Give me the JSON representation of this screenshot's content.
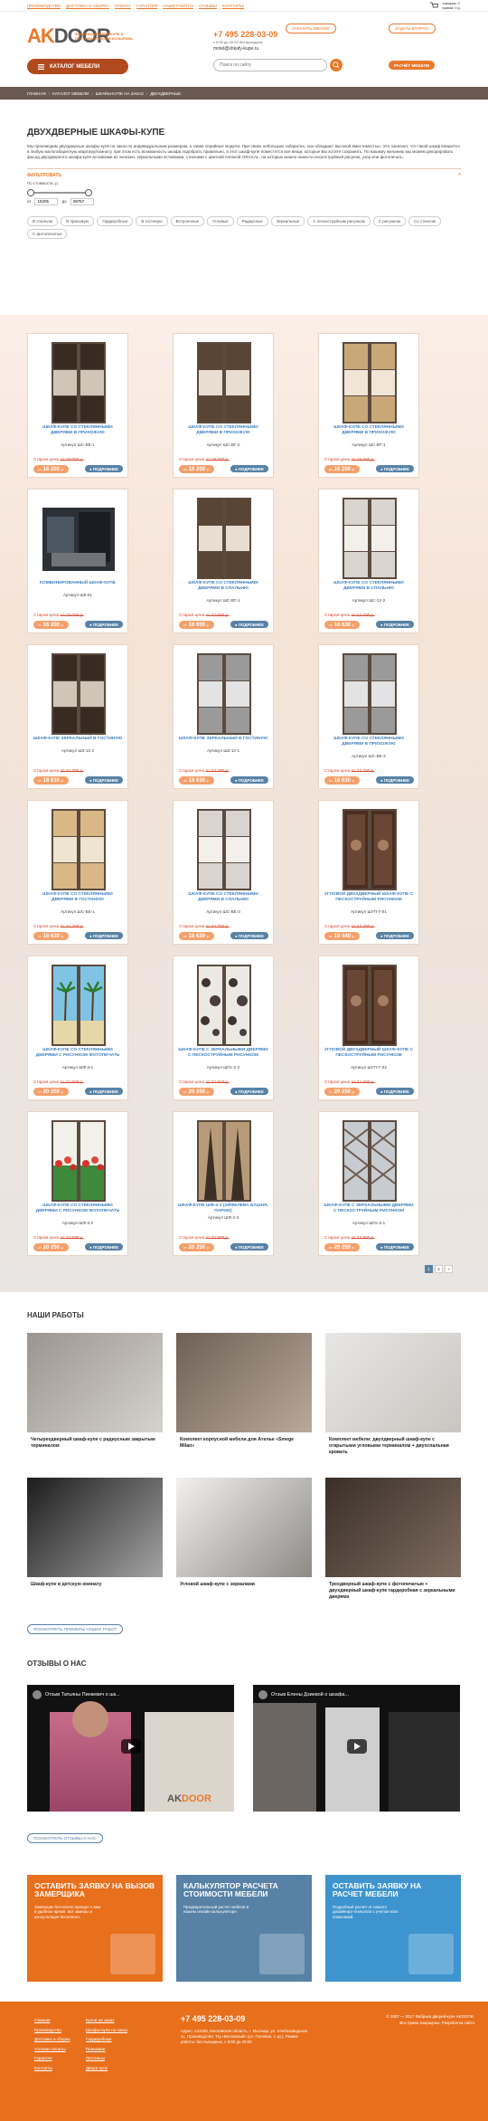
{
  "topnav": {
    "links": [
      "ПРОИЗВОДСТВО",
      "ДОСТАВКА И СБОРКА",
      "ОПЛАТА",
      "ГАРАНТИЯ",
      "НАШИ РАБОТЫ",
      "ОТЗЫВЫ",
      "КОНТАКТЫ"
    ],
    "cart_count": "товаров: 0",
    "cart_sum": "сумма: 0 р."
  },
  "header": {
    "logo_a": "AK",
    "logo_b": "DOOR",
    "tagline": "ФАБРИКА ДВЕРЕЙ-КУПЕ И ЛЕСТНИЦ АЛЕКСЕЯ КОЗЫРЕВА",
    "phone": "+7 495 228-03-09",
    "phone_sub": "с 9:00 до 20:00 без выходных",
    "email": "motel@shkafy-kupe.ru",
    "callback": "ЗАКАЗАТЬ ЗВОНОК",
    "ask": "ЗАДАТЬ ВОПРОС",
    "catalog": "КАТАЛОГ МЕБЕЛИ",
    "search_placeholder": "Поиск по сайту",
    "calc": "РАСЧЁТ МЕБЕЛИ"
  },
  "breadcrumbs": [
    "ГЛАВНАЯ",
    "КАТАЛОГ МЕБЕЛИ",
    "ШКАФЫ-КУПЕ НА ЗАКАЗ",
    "ДВУХДВЕРНЫЕ"
  ],
  "page": {
    "title": "ДВУХДВЕРНЫЕ ШКАФЫ-КУПЕ",
    "intro": "Мы производим двухдверные шкафы-купе на заказ по индивидуальным размерам, а также серийные модели. При своих небольших габаритах, они обладают высокой вместимостью. Это означает, что такой шкаф впишется в любую малогабаритную квартиру/комнату, при этом есть возможность шкафа подобрать правильно, в этот шкаф-купе поместятся все вещи, которые Вы хотите сохранить. По вашему желанию мы можем декорировать фасад двухдверного шкафа-купе вставками из экокожи, зеркальными вставками, стеклами с цветной пленкой ORACAL, на которые можно нанести пескоструйный рисунок, узор или фотопечать."
  },
  "filter": {
    "title": "ФИЛЬТРОВАТЬ",
    "price_label": "По стоимости, р.",
    "from_label": "от",
    "from": "15205",
    "to_label": "до",
    "to": "29757",
    "tags": [
      "В спальню",
      "В прихожую",
      "Гардеробные",
      "В гостиную",
      "Встроенные",
      "Угловые",
      "Радиусные",
      "Зеркальные",
      "С пескоструйным рисунком",
      "С рисунком",
      "Со стеклом",
      "С фотопечатью"
    ]
  },
  "catalog": {
    "old_label": "Старая цена",
    "price_prefix": "от",
    "more": "ПОДРОБНЕЕ",
    "items": [
      {
        "name": "ШКАФ-КУПЕ СО СТЕКЛЯННЫМИ ДВЕРЯМИ В ПРИХОЖУЮ",
        "art": "Артикул ШС-ВЕ-1",
        "old": "от 19 000 р.",
        "price": "16 200",
        "door": "dark"
      },
      {
        "name": "ШКАФ-КУПЕ СО СТЕКЛЯННЫМИ ДВЕРЯМИ В ПРИХОЖУЮ",
        "art": "Артикул ШС-ВГ-2",
        "old": "от 19 000 р.",
        "price": "16 200",
        "door": "wenge"
      },
      {
        "name": "ШКАФ-КУПЕ СО СТЕКЛЯННЫМИ ДВЕРЯМИ В ПРИХОЖУЮ",
        "art": "Артикул ШС-ВТ-1",
        "old": "от 19 000 р.",
        "price": "16 200",
        "door": "light"
      },
      {
        "name": "КОМБИНИРОВАННЫЙ ШКАФ-КУПЕ",
        "art": "Артикул ШК-К1",
        "old": "от 19 000 р.",
        "price": "16 200",
        "door": "room"
      },
      {
        "name": "ШКАФ-КУПЕ СО СТЕКЛЯННЫМИ ДВЕРЯМИ В СПАЛЬНЮ",
        "art": "Артикул ШС-ВТ-1",
        "old": "от 22 000 р.",
        "price": "18 000",
        "door": "wenge"
      },
      {
        "name": "ШКАФ-КУПЕ СО СТЕКЛЯННЫМИ ДВЕРЯМИ В СПАЛЬНЮ",
        "art": "Артикул ШС-12-2",
        "old": "от 22 700 р.",
        "price": "18 630",
        "door": "white"
      },
      {
        "name": "ШКАФ-КУПЕ ЗЕРКАЛЬНЫЙ В ГОСТИНУЮ",
        "art": "Артикул ШЗ-12-2",
        "old": "от 22 700 р.",
        "price": "18 630",
        "door": "dark"
      },
      {
        "name": "ШКАФ-КУПЕ ЗЕРКАЛЬНЫЙ В ГОСТИНУЮ",
        "art": "Артикул ШЗ-12-1",
        "old": "от 22 700 р.",
        "price": "18 630",
        "door": "grey"
      },
      {
        "name": "ШКАФ-КУПЕ СО СТЕКЛЯННЫМИ ДВЕРЯМИ В ПРИХОЖУЮ",
        "art": "Артикул ШС-ВЕ-2",
        "old": "от 22 700 р.",
        "price": "18 630",
        "door": "grey"
      },
      {
        "name": "ШКАФ-КУПЕ СО СТЕКЛЯННЫМИ ДВЕРЯМИ В ГОСТИНУЮ",
        "art": "Артикул ШС-ВЕ-1",
        "old": "от 22 700 р.",
        "price": "18 630",
        "door": "beige"
      },
      {
        "name": "ШКАФ-КУПЕ СО СТЕКЛЯННЫМИ ДВЕРЯМИ В СПАЛЬНЮ",
        "art": "Артикул ШС-ВЕ-3",
        "old": "от 22 700 р.",
        "price": "18 630",
        "door": "white"
      },
      {
        "name": "УГЛОВОЙ ДВУХДВЕРНЫЙ ШКАФ-КУПЕ С ПЕСКОСТРУЙНЫМ РИСУНКОМ",
        "art": "Артикул ШУП-Т-01",
        "old": "от 23 400 р.",
        "price": "19 440",
        "door": "corner"
      },
      {
        "name": "ШКАФ-КУПЕ СО СТЕКЛЯННЫМИ ДВЕРЯМИ С РИСУНКОМ ФОТОПЕЧАТЬ",
        "art": "Артикул ШФ-3-1",
        "old": "от 22 500 р.",
        "price": "20 250",
        "door": "palm"
      },
      {
        "name": "ШКАФ-КУПЕ С ЗЕРКАЛЬНЫМИ ДВЕРЯМИ С ПЕСКОСТРУЙНЫМ РИСУНКОМ",
        "art": "Артикул ШПс-2-2",
        "old": "от 22 500 р.",
        "price": "20 250",
        "door": "flower"
      },
      {
        "name": "УГЛОВОЙ ДВУХДВЕРНЫЙ ШКАФ-КУПЕ С ПЕСКОСТРУЙНЫМ РИСУНКОМ",
        "art": "Артикул ШУП-Т-02",
        "old": "от 22 500 р.",
        "price": "20 250",
        "door": "corner"
      },
      {
        "name": "ШКАФ-КУПЕ СО СТЕКЛЯННЫМИ ДВЕРЯМИ С РИСУНКОМ ФОТОПЕЧАТЬ",
        "art": "Артикул ШФ-3-2",
        "old": "от 22 500 р.",
        "price": "20 250",
        "door": "tulip"
      },
      {
        "name": "ШКАФ-КУПЕ ШФ-2-3 (ЭЙФЕЛЕВА БАШНЯ, ПАРИЖ)",
        "art": "Артикул ШФ-2-3",
        "old": "от 22 500 р.",
        "price": "20 250",
        "door": "tower"
      },
      {
        "name": "ШКАФ-КУПЕ С ЗЕРКАЛЬНЫМИ ДВЕРЯМИ С ПЕСКОСТРУЙНЫМ РИСУНКОМ",
        "art": "Артикул ШПс-2-1",
        "old": "от 22 500 р.",
        "price": "20 250",
        "door": "pattern"
      }
    ],
    "pages": [
      "1",
      "2",
      "»"
    ]
  },
  "works": {
    "title": "НАШИ РАБОТЫ",
    "items": [
      "Четырехдверный шкаф-купе с радиусным закрытым терминалом",
      "Комплект корпусной мебели для Ателье «Smege Milan»",
      "Комплект мебели: двухдверный шкаф-купе с открытыми угловыми терминалом + двухспальная кровать",
      "Шкаф-купе в детскую комнату",
      "Угловой шкаф-купе с зеркалами",
      "Трехдверный шкаф-купе с фотопечатью + двухдверный шкаф-купе гардеробная с зеркальными дверями"
    ],
    "more": "ПОСМОТРЕТЬ ПРИМЕРЫ НАШИХ РАБОТ"
  },
  "reviews": {
    "title": "ОТЗЫВЫ О НАС",
    "v1": "Отзыв Татьяны Пинкевич о шк...",
    "v2": "Отзыв Елены Дзиевой о шкафа...",
    "more": "ПОСМОТРЕТЬ ОТЗЫВЫ О НАС"
  },
  "promos": [
    {
      "title": "ОСТАВИТЬ ЗАЯВКУ НА ВЫЗОВ ЗАМЕРЩИКА",
      "desc": "Замерщик бесплатно приедет к вам в удобное время, все замеры и консультация бесплатно.",
      "color": "#e86f1c"
    },
    {
      "title": "КАЛЬКУЛЯТОР РАСЧЕТА СТОИМОСТИ МЕБЕЛИ",
      "desc": "Предварительный расчет мебели в нашем онлайн калькуляторе.",
      "color": "#5782a6"
    },
    {
      "title": "ОСТАВИТЬ ЗАЯВКУ НА РАСЧЕТ МЕБЕЛИ",
      "desc": "Подробный расчет от нашего дизайнера-технолога с учетом всех пожеланий.",
      "color": "#3d94cf"
    }
  ],
  "footer": {
    "col1": [
      "Главная",
      "Производство",
      "Доставка и сборка",
      "Условия оплаты",
      "Гарантия",
      "Контакты"
    ],
    "col2": [
      "Кухни на заказ",
      "Шкафы-купе на заказ",
      "Гардеробные",
      "Прихожие",
      "Лестницы",
      "Двери-купе"
    ],
    "phone": "+7 495 228-03-09",
    "info": "Адрес: 141008, Московская область, г. Мытищи, ул. Хлебозаводская 1с. Производство: ТЦ «Велозовый» (ул. Полевая, 1 зд.). Режим работы: без выходных, с 9:00 до 20:00",
    "copy": "© 2007 — 2017 Фабрика дверей-купе AKDOOR. Все права защищены. Разработка сайта"
  }
}
